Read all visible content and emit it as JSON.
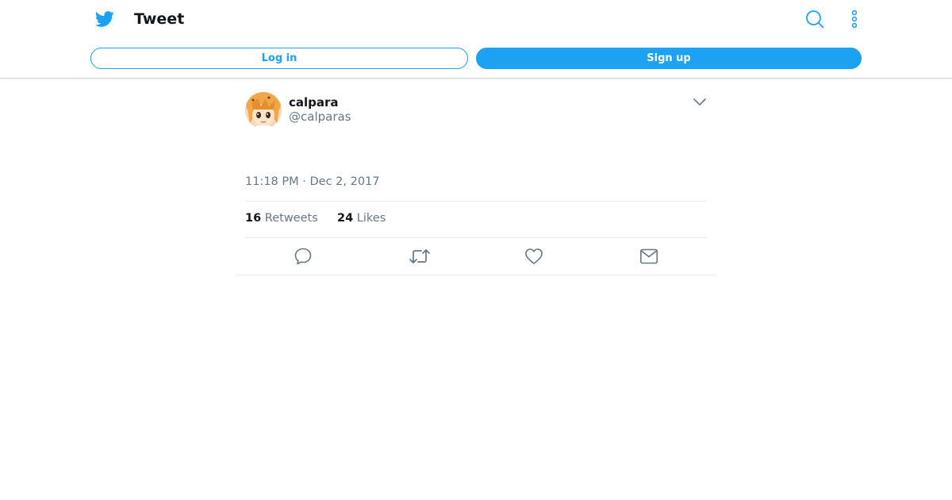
{
  "header": {
    "title": "Tweet",
    "login_label": "Log in",
    "signup_label": "Sign up",
    "icons": [
      "twitter-bird-icon",
      "search-icon",
      "more-vertical-icon"
    ],
    "accent_color": "#1da1f2"
  },
  "tweet": {
    "display_name": "calpara",
    "handle": "@calparas",
    "timestamp": "11:18 PM · Dec 2, 2017",
    "retweets_count": "16",
    "retweets_label": "Retweets",
    "likes_count": "24",
    "likes_label": "Likes",
    "actions": [
      "reply-icon",
      "retweet-icon",
      "like-icon",
      "direct-message-icon"
    ]
  }
}
